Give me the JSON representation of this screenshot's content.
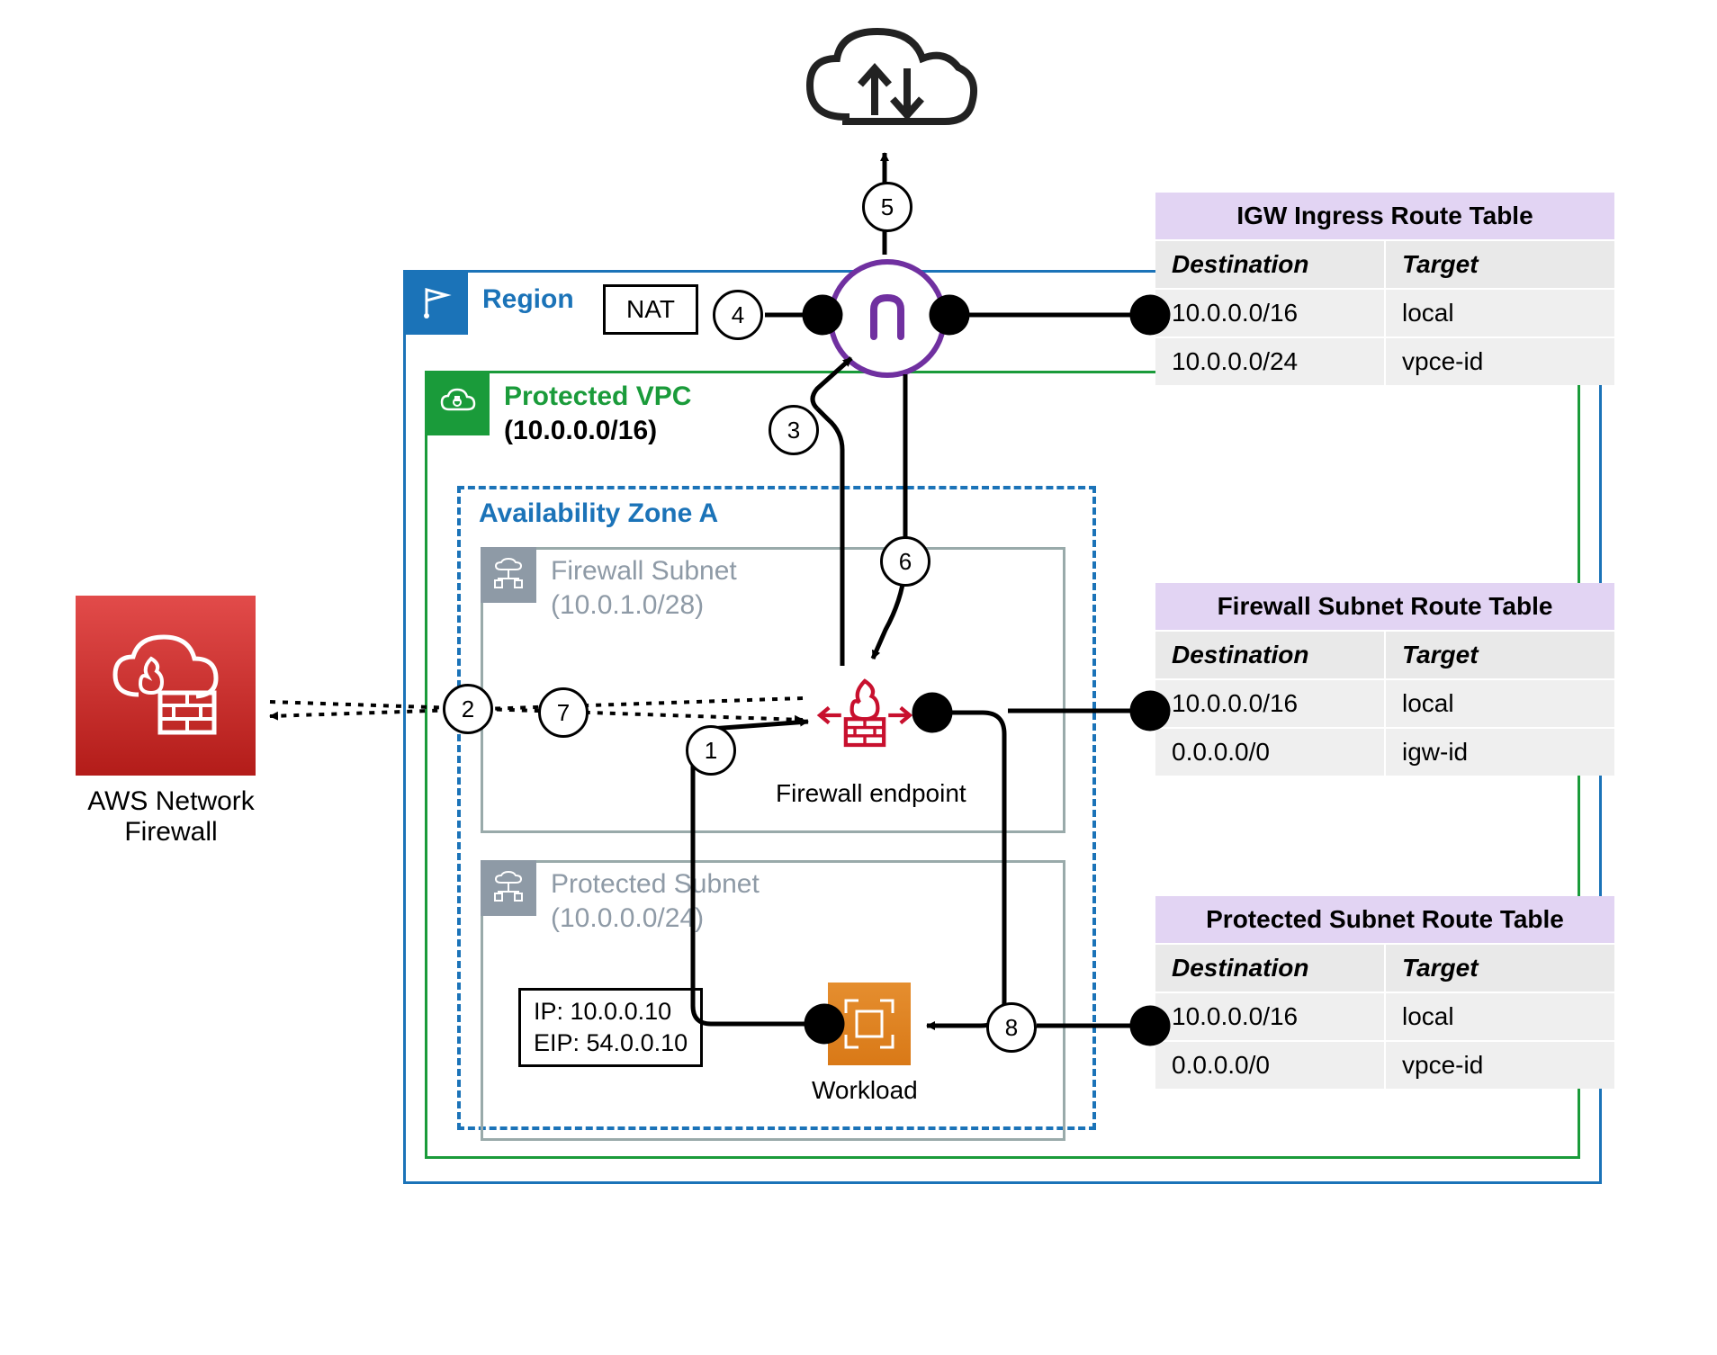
{
  "region_label": "Region",
  "nat_label": "NAT",
  "vpc_label": "Protected VPC",
  "vpc_cidr": "(10.0.0.0/16)",
  "az_label": "Availability Zone A",
  "firewall_subnet": {
    "label": "Firewall Subnet",
    "cidr": "(10.0.1.0/28)"
  },
  "protected_subnet": {
    "label": "Protected Subnet",
    "cidr": "(10.0.0.0/24)"
  },
  "firewall_endpoint_label": "Firewall endpoint",
  "workload_label": "Workload",
  "workload_ip_line1": "IP: 10.0.0.10",
  "workload_ip_line2": "EIP: 54.0.0.10",
  "anf_label": "AWS Network Firewall",
  "route_tables": [
    {
      "title": "IGW Ingress Route Table",
      "headers": [
        "Destination",
        "Target"
      ],
      "rows": [
        [
          "10.0.0.0/16",
          "local"
        ],
        [
          "10.0.0.0/24",
          "vpce-id"
        ]
      ]
    },
    {
      "title": "Firewall Subnet Route Table",
      "headers": [
        "Destination",
        "Target"
      ],
      "rows": [
        [
          "10.0.0.0/16",
          "local"
        ],
        [
          "0.0.0.0/0",
          "igw-id"
        ]
      ]
    },
    {
      "title": "Protected Subnet Route Table",
      "headers": [
        "Destination",
        "Target"
      ],
      "rows": [
        [
          "10.0.0.0/16",
          "local"
        ],
        [
          "0.0.0.0/0",
          "vpce-id"
        ]
      ]
    }
  ],
  "steps": [
    "1",
    "2",
    "3",
    "4",
    "5",
    "6",
    "7",
    "8"
  ]
}
